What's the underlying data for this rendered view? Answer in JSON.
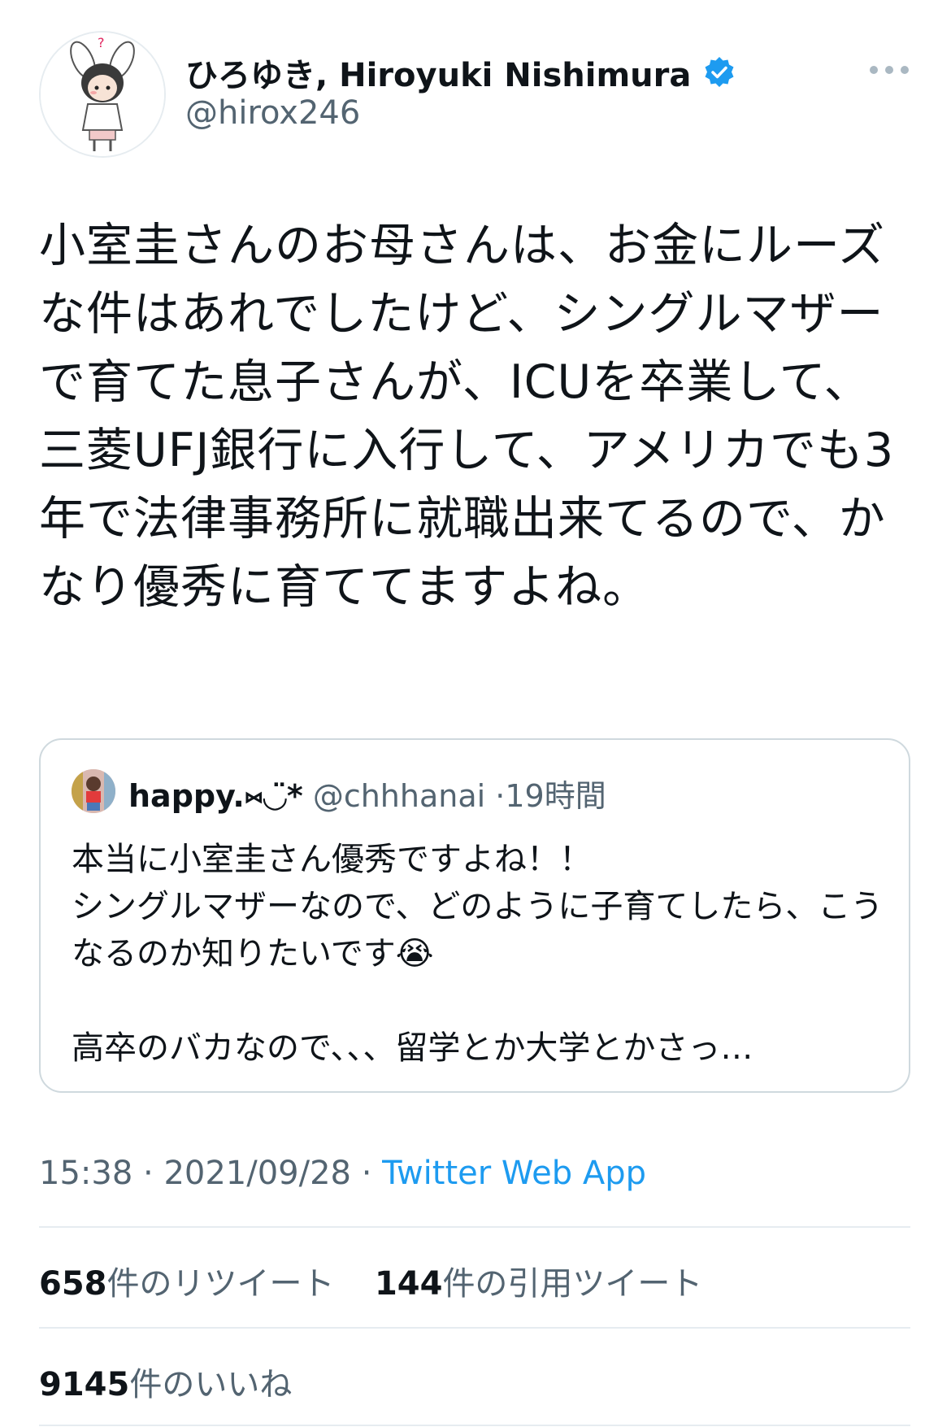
{
  "tweet": {
    "author": {
      "display_name": "ひろゆき, Hiroyuki Nishimura",
      "handle": "@hirox246",
      "verified": true
    },
    "text": "小室圭さんのお母さんは、お金にルーズな件はあれでしたけど、シングルマザーで育てた息子さんが、ICUを卒業して、三菱UFJ銀行に入行して、アメリカでも3年で法律事務所に就職出来てるので、かなり優秀に育ててますよね。",
    "quoted": {
      "display_name": "happy.⑅◡̈*",
      "handle": "@chhhanai",
      "time": "19時間",
      "text": "本当に小室圭さん優秀ですよね！！\nシングルマザーなので、どのように子育てしたら、こうなるのか知りたいです😭\n\n高卒のバカなので、、、留学とか大学とかさっ…"
    },
    "time": "15:38",
    "date": "2021/09/28",
    "separator": "·",
    "app": "Twitter Web App",
    "stats": {
      "retweets_count": "658",
      "retweets_label": "件のリツイート",
      "quotes_count": "144",
      "quotes_label": "件の引用ツイート",
      "likes_count": "9145",
      "likes_label": "件のいいね"
    }
  },
  "colors": {
    "accent": "#1d9bf0",
    "secondary_text": "#536471",
    "primary_text": "#0f1419",
    "border": "#cfd9de"
  },
  "icons": {
    "verified": "verified-badge-icon",
    "more": "more-options-icon"
  }
}
